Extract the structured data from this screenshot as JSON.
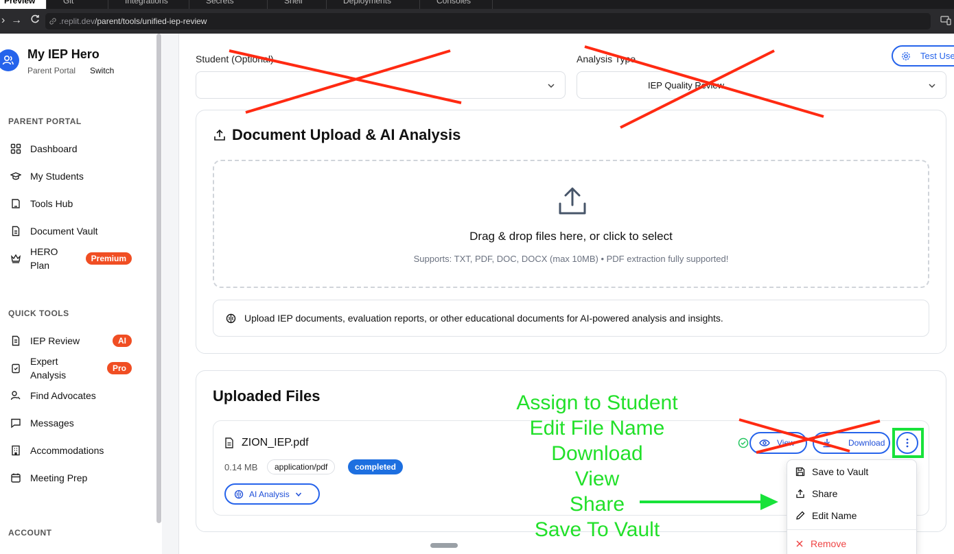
{
  "browser": {
    "tabs": [
      "Preview",
      "Git",
      "Integrations",
      "Secrets",
      "Shell",
      "Deployments",
      "Consoles"
    ],
    "url_dim": ".replit.dev",
    "url_path": "/parent/tools/unified-iep-review"
  },
  "sidebar": {
    "brand_title": "My IEP Hero",
    "brand_sub": "Parent Portal",
    "switch_label": "Switch",
    "section_parent": "PARENT PORTAL",
    "parent_items": [
      {
        "label": "Dashboard",
        "icon": "dashboard-icon"
      },
      {
        "label": "My Students",
        "icon": "graduation-cap-icon"
      },
      {
        "label": "Tools Hub",
        "icon": "tools-icon"
      },
      {
        "label": "Document Vault",
        "icon": "document-icon"
      },
      {
        "label": "HERO Plan",
        "icon": "crown-icon",
        "badge": "Premium"
      }
    ],
    "section_quick": "QUICK TOOLS",
    "quick_items": [
      {
        "label": "IEP Review",
        "icon": "file-text-icon",
        "badge": "AI"
      },
      {
        "label": "Expert Analysis",
        "icon": "clipboard-check-icon",
        "badge": "Pro"
      },
      {
        "label": "Find Advocates",
        "icon": "user-search-icon"
      },
      {
        "label": "Messages",
        "icon": "message-icon"
      },
      {
        "label": "Accommodations",
        "icon": "building-icon"
      },
      {
        "label": "Meeting Prep",
        "icon": "calendar-icon"
      }
    ],
    "section_account": "ACCOUNT"
  },
  "filters": {
    "student_label": "Student (Optional)",
    "student_value": "",
    "analysis_label": "Analysis Type",
    "analysis_value": "IEP Quality Review",
    "test_button": "Test Use"
  },
  "upload": {
    "title": "Document Upload & AI Analysis",
    "drop_title": "Drag & drop files here, or click to select",
    "drop_sub": "Supports: TXT, PDF, DOC, DOCX (max 10MB) • PDF extraction fully supported!",
    "info": "Upload IEP documents, evaluation reports, or other educational documents for AI-powered analysis and insights."
  },
  "files": {
    "title": "Uploaded Files",
    "items": [
      {
        "name": "ZION_IEP.pdf",
        "size": "0.14 MB",
        "mime": "application/pdf",
        "status": "completed",
        "ai_label": "AI Analysis",
        "view_label": "View",
        "download_label": "Download"
      }
    ]
  },
  "menu": {
    "items": [
      "Save to Vault",
      "Share",
      "Edit Name"
    ],
    "danger": "Remove"
  },
  "annotations": [
    "Assign to Student",
    "Edit File Name",
    "Download",
    "View",
    "Share",
    "Save To Vault"
  ],
  "colors": {
    "accent": "#2563eb",
    "badge": "#f04e23",
    "annotation": "#18e23a",
    "strike": "#ff2a12"
  }
}
